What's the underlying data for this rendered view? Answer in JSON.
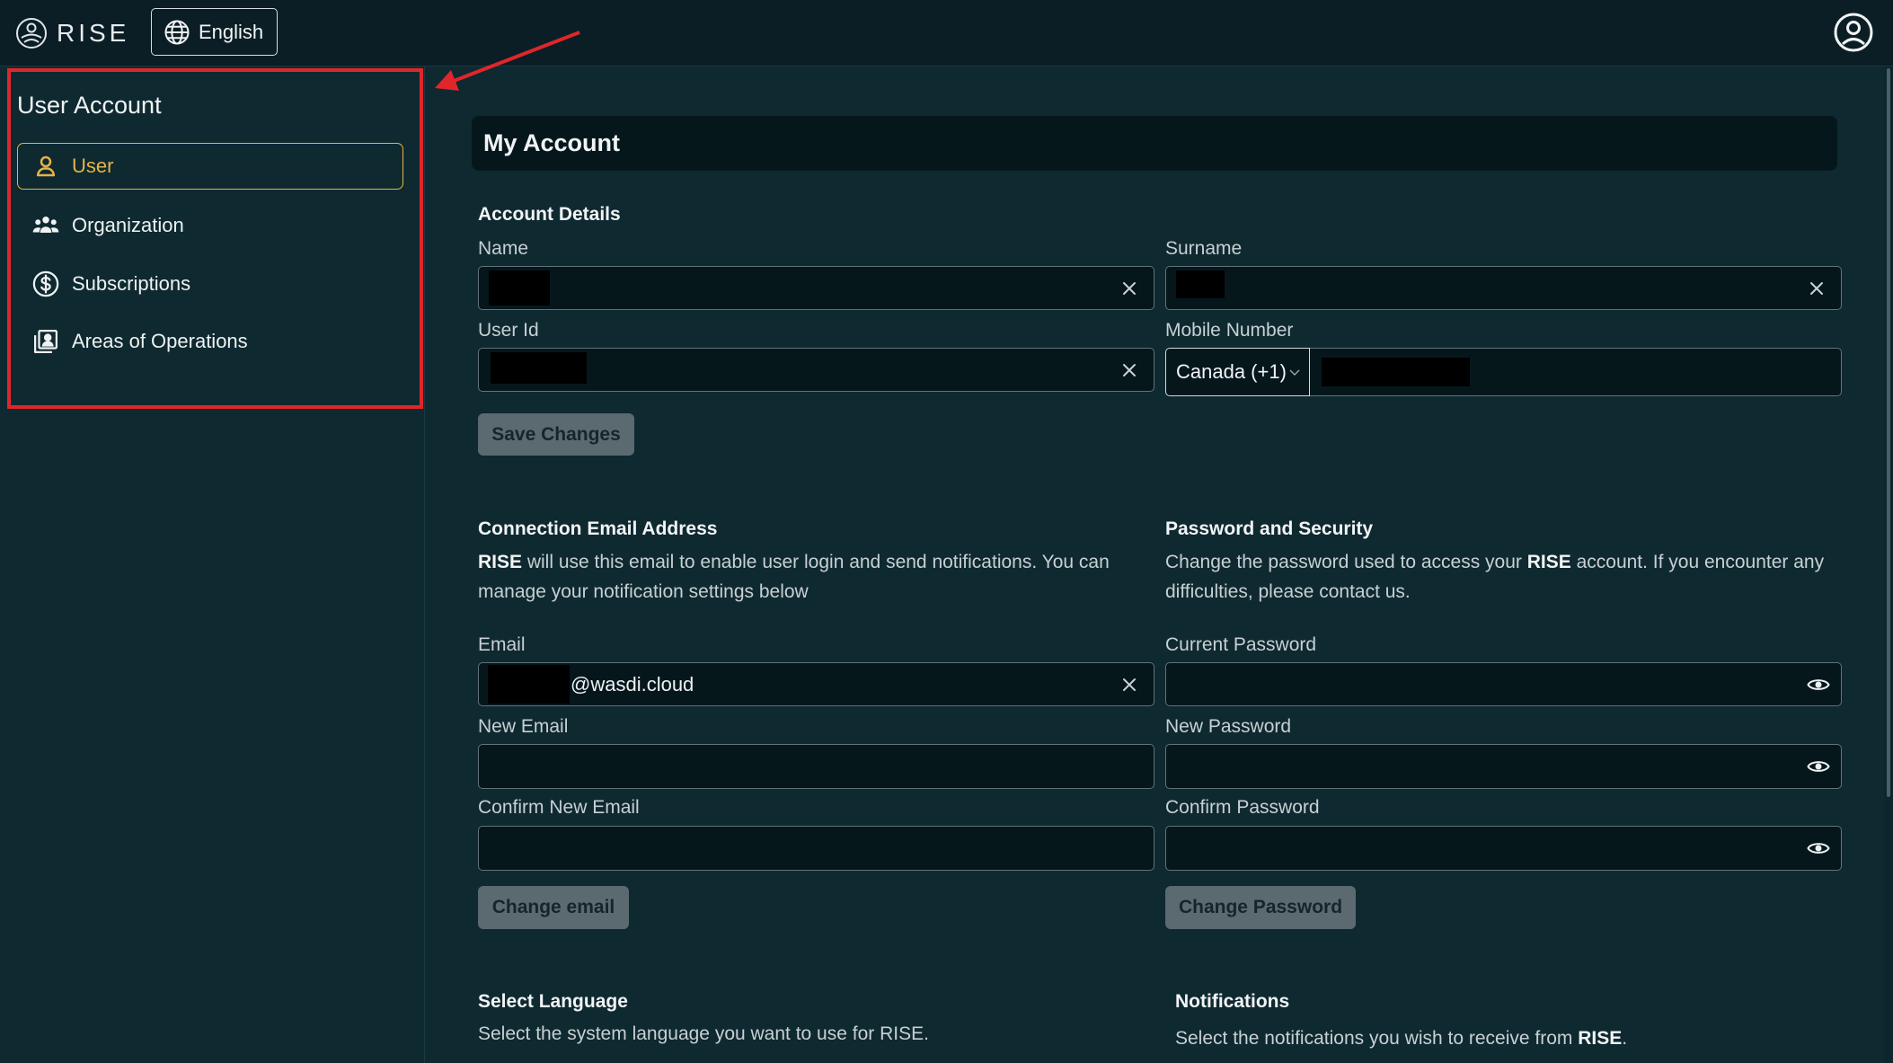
{
  "topbar": {
    "logo_text": "RISE",
    "language_label": "English",
    "icons": {
      "logo": "rise-logo-icon",
      "language": "globe-icon",
      "account": "account-circle-icon"
    }
  },
  "sidebar": {
    "title": "User Account",
    "items": [
      {
        "label": "User",
        "icon": "user-icon",
        "active": true
      },
      {
        "label": "Organization",
        "icon": "group-icon",
        "active": false
      },
      {
        "label": "Subscriptions",
        "icon": "dollar-circle-icon",
        "active": false
      },
      {
        "label": "Areas of Operations",
        "icon": "map-pin-book-icon",
        "active": false
      }
    ]
  },
  "main": {
    "page_title": "My Account",
    "account_details": {
      "heading": "Account Details",
      "name_label": "Name",
      "surname_label": "Surname",
      "user_id_label": "User Id",
      "mobile_label": "Mobile Number",
      "country_code": "Canada (+1)",
      "save_button": "Save Changes"
    },
    "email_section": {
      "heading": "Connection Email Address",
      "description_brand": "RISE",
      "description": " will use this email to enable user login and send notifications. You can manage your notification settings below",
      "email_label": "Email",
      "email_value": "@wasdi.cloud",
      "new_email_label": "New Email",
      "confirm_email_label": "Confirm New Email",
      "change_button": "Change email"
    },
    "password_section": {
      "heading": "Password and Security",
      "description_start": "Change the password used to access your ",
      "description_brand": "RISE",
      "description_end": " account. If you encounter any difficulties, please contact us.",
      "current_label": "Current Password",
      "new_label": "New Password",
      "confirm_label": "Confirm Password",
      "change_button": "Change Password"
    },
    "language_section": {
      "heading": "Select Language",
      "description": "Select the system language you want to use for RISE."
    },
    "notifications_section": {
      "heading": "Notifications",
      "description_start": "Select the notifications you wish to receive from ",
      "description_brand": "RISE",
      "description_end": "."
    }
  },
  "colors": {
    "background": "#0f2930",
    "topbar": "#0b1e25",
    "accent_gold": "#e4b447",
    "button": "#5a6a70",
    "annotation_red": "#e0262b"
  }
}
